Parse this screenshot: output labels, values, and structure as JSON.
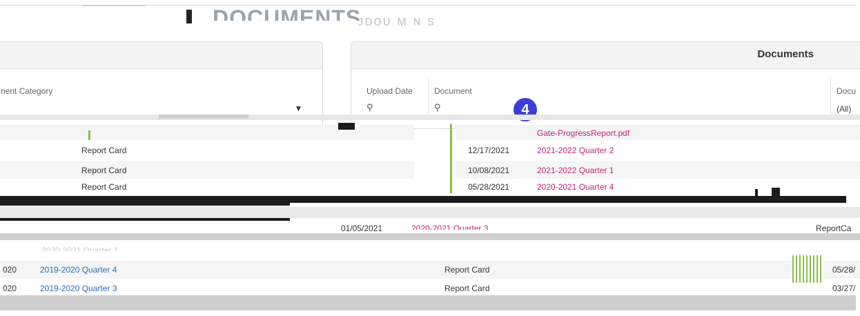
{
  "header": {
    "title": "DOCUMENTS",
    "ghost_text": "ᴊᴅᴏᴜ ᴍ  ɴ  ѕ"
  },
  "left_panel": {
    "column_header": "nent Category",
    "rows": [
      {
        "category": "Report Card"
      },
      {
        "category": "Report Card"
      },
      {
        "category": "Report Card"
      }
    ]
  },
  "right_panel": {
    "title": "Documents",
    "columns": {
      "upload_date": "Upload Date",
      "document": "Document",
      "doc_category": "Docu"
    },
    "filter_value": "(All)",
    "badge_number": "4",
    "rows": [
      {
        "date": "",
        "document": "Gate-ProgressReport.pdf"
      },
      {
        "date": "12/17/2021",
        "document": "2021-2022 Quarter 2"
      },
      {
        "date": "10/08/2021",
        "document": "2021-2022 Quarter 1"
      },
      {
        "date": "05/28/2021",
        "document": "2020-2021 Quarter 4"
      }
    ]
  },
  "middle": {
    "date_1": "01/05/2021",
    "doc_1": "2020-2021 Quarter 3",
    "label_fragment": "ReportCa",
    "quarter_ghost": "2020-2021 Quarter 1"
  },
  "bottom_rows": [
    {
      "year_frag": "020",
      "document": "2019-2020 Quarter 4",
      "category": "Report Card",
      "date_frag": "05/28/"
    },
    {
      "year_frag": "020",
      "document": "2019-2020 Quarter 3",
      "category": "Report Card",
      "date_frag": "03/27/"
    }
  ],
  "colors": {
    "link": "#c0257d",
    "blue_link": "#2a6db8",
    "badge": "#3b3fd6",
    "accent_green": "#88c040"
  }
}
